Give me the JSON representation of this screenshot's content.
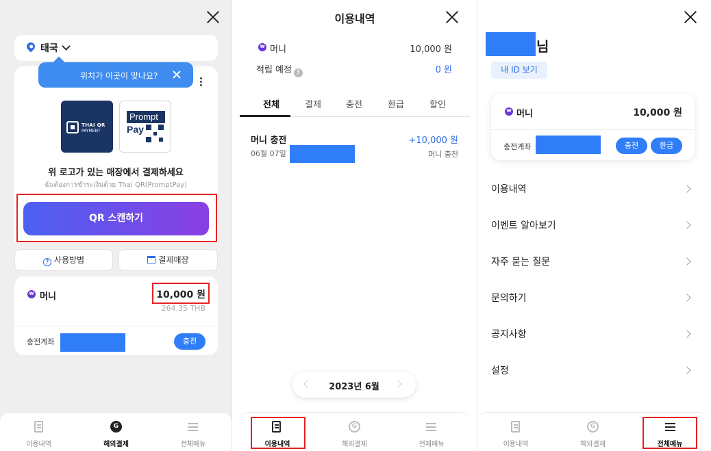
{
  "panel1": {
    "location": "태국",
    "tooltip": "위치가 이곳이 맞나요?",
    "thai_qr": {
      "line1": "THAI QR",
      "line2": "PAYMENT"
    },
    "promptpay": {
      "line1": "Prompt",
      "line2": "Pay"
    },
    "pay_main": "위 로고가 있는 매장에서 결제하세요",
    "pay_sub": "ฉันต้องการชำระเงินด้วย Thai QR(PromptPay)",
    "qr_button": "QR 스캔하기",
    "how_to_use": "사용방법",
    "stores": "결제매장",
    "money_label": "머니",
    "money_value": "10,000 원",
    "money_thb": "264.35 THB",
    "account_label": "충전계좌",
    "charge_button": "충전"
  },
  "panel2": {
    "title": "이용내역",
    "money_label": "머니",
    "money_value": "10,000 원",
    "points_label": "적립 예정",
    "points_value": "0 원",
    "tabs": [
      "전체",
      "결제",
      "충전",
      "환급",
      "할인"
    ],
    "transaction": {
      "title": "머니 충전",
      "date": "06월 07일",
      "amount": "+10,000 원",
      "type": "머니 충전"
    },
    "month": "2023년 6월"
  },
  "panel3": {
    "name_suffix": "님",
    "view_id": "내 ID 보기",
    "money_label": "머니",
    "money_value": "10,000 원",
    "account_label": "충전계좌",
    "charge_button": "충전",
    "refund_button": "환급",
    "menu": [
      "이용내역",
      "이벤트 알아보기",
      "자주 묻는 질문",
      "문의하기",
      "공지사항",
      "설정"
    ]
  },
  "nav": {
    "history": "이용내역",
    "overseas": "해외결제",
    "menu": "전체메뉴"
  },
  "icons": {
    "money": "e-money-icon",
    "info": "info-icon"
  },
  "colors": {
    "accent_blue": "#2f7ef7",
    "gradient_start": "#4c61f2",
    "gradient_end": "#8a3ee2",
    "highlight_red": "#e52222",
    "money_purple": "#6b36d8"
  }
}
